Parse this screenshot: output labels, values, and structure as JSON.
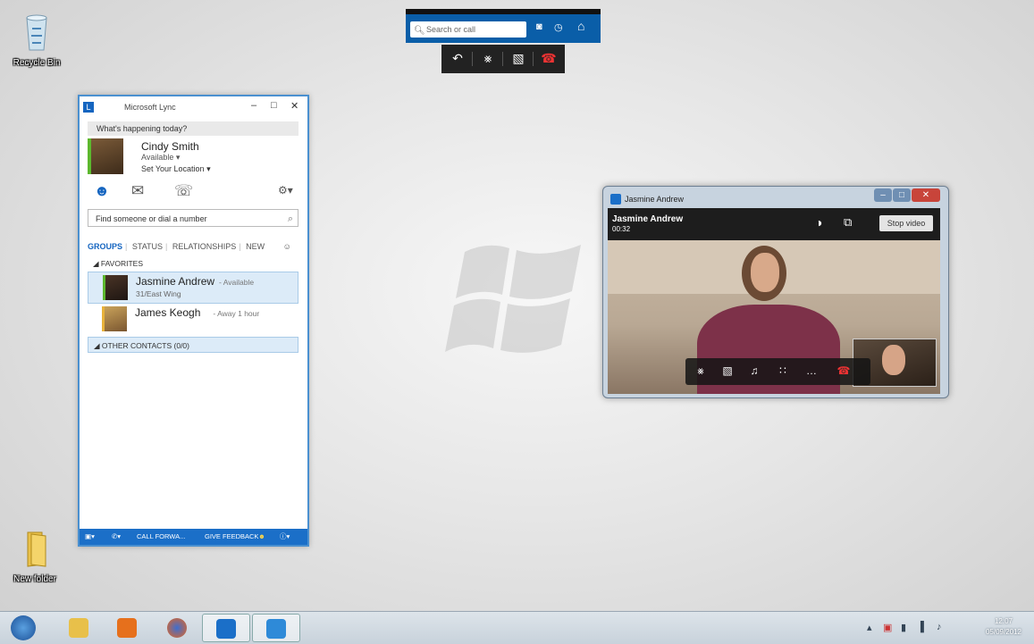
{
  "desktop": {
    "icons": [
      {
        "label": "Recycle Bin"
      },
      {
        "label": "New folder"
      }
    ]
  },
  "call_bar": {
    "search_placeholder": "Search or call"
  },
  "lync": {
    "title": "Microsoft Lync",
    "status_note": "What's happening today?",
    "me": {
      "name": "Cindy Smith",
      "availability": "Available",
      "location": "Set Your Location"
    },
    "find_placeholder": "Find someone or dial a number",
    "tabs": [
      "GROUPS",
      "STATUS",
      "RELATIONSHIPS",
      "NEW"
    ],
    "favorites_label": "FAVORITES",
    "contacts": [
      {
        "name": "Jasmine Andrew",
        "status": "- Available",
        "location": "31/East Wing"
      },
      {
        "name": "James Keogh",
        "status": "- Away 1 hour",
        "location": ""
      }
    ],
    "other_contacts_label": "OTHER CONTACTS (0/0)",
    "footer": {
      "call_forward": "CALL FORWA...",
      "feedback": "GIVE FEEDBACK"
    }
  },
  "video_call": {
    "window_title": "Jasmine Andrew",
    "caller": "Jasmine Andrew",
    "duration": "00:32",
    "stop_video_label": "Stop video"
  },
  "taskbar": {
    "time": "12:07",
    "date": "05/09/2012"
  },
  "colors": {
    "lync_blue": "#1b6fc8",
    "available_green": "#5cb82e",
    "hangup_red": "#d22"
  }
}
